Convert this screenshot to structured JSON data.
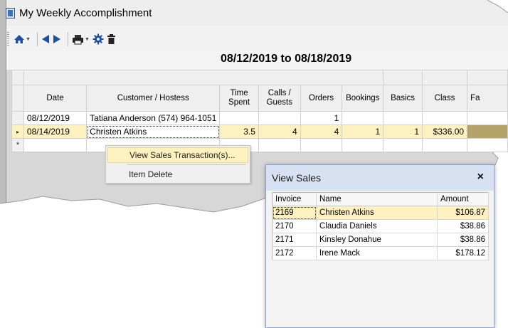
{
  "window": {
    "title": "My Weekly Accomplishment"
  },
  "toolbar": {
    "icons": [
      "home-icon",
      "back-arrow-icon",
      "forward-arrow-icon",
      "print-icon",
      "gear-icon",
      "trash-icon"
    ]
  },
  "date_range": "08/12/2019 to 08/18/2019",
  "grid": {
    "columns": [
      "Date",
      "Customer / Hostess",
      "Time Spent",
      "Calls / Guests",
      "Orders",
      "Bookings",
      "Basics",
      "Class",
      "Fa"
    ],
    "rows": [
      {
        "date": "08/12/2019",
        "customer": "Tatiana Anderson (574) 964-1051",
        "time": "",
        "calls": "",
        "orders": "1",
        "bookings": "",
        "basics": "",
        "class": ""
      },
      {
        "date": "08/14/2019",
        "customer": "Christen Atkins",
        "time": "3.5",
        "calls": "4",
        "orders": "4",
        "bookings": "1",
        "basics": "1",
        "class": "$336.00"
      }
    ],
    "new_row_marker": "*",
    "current_row_marker": "▸"
  },
  "context_menu": {
    "items": [
      {
        "label": "View Sales Transaction(s)..."
      },
      {
        "label": "Item Delete"
      }
    ]
  },
  "dialog": {
    "title": "View Sales",
    "close": "×",
    "columns": [
      "Invoice",
      "Name",
      "Amount"
    ],
    "rows": [
      {
        "invoice": "2169",
        "name": "Christen Atkins",
        "amount": "$106.87"
      },
      {
        "invoice": "2170",
        "name": "Claudia Daniels",
        "amount": "$38.86"
      },
      {
        "invoice": "2171",
        "name": "Kinsley Donahue",
        "amount": "$38.86"
      },
      {
        "invoice": "2172",
        "name": "Irene Mack",
        "amount": "$178.12"
      }
    ]
  },
  "colors": {
    "selection": "#fdf2bf",
    "accent": "#2356a8",
    "dialog_header": "#d8e1f2"
  }
}
